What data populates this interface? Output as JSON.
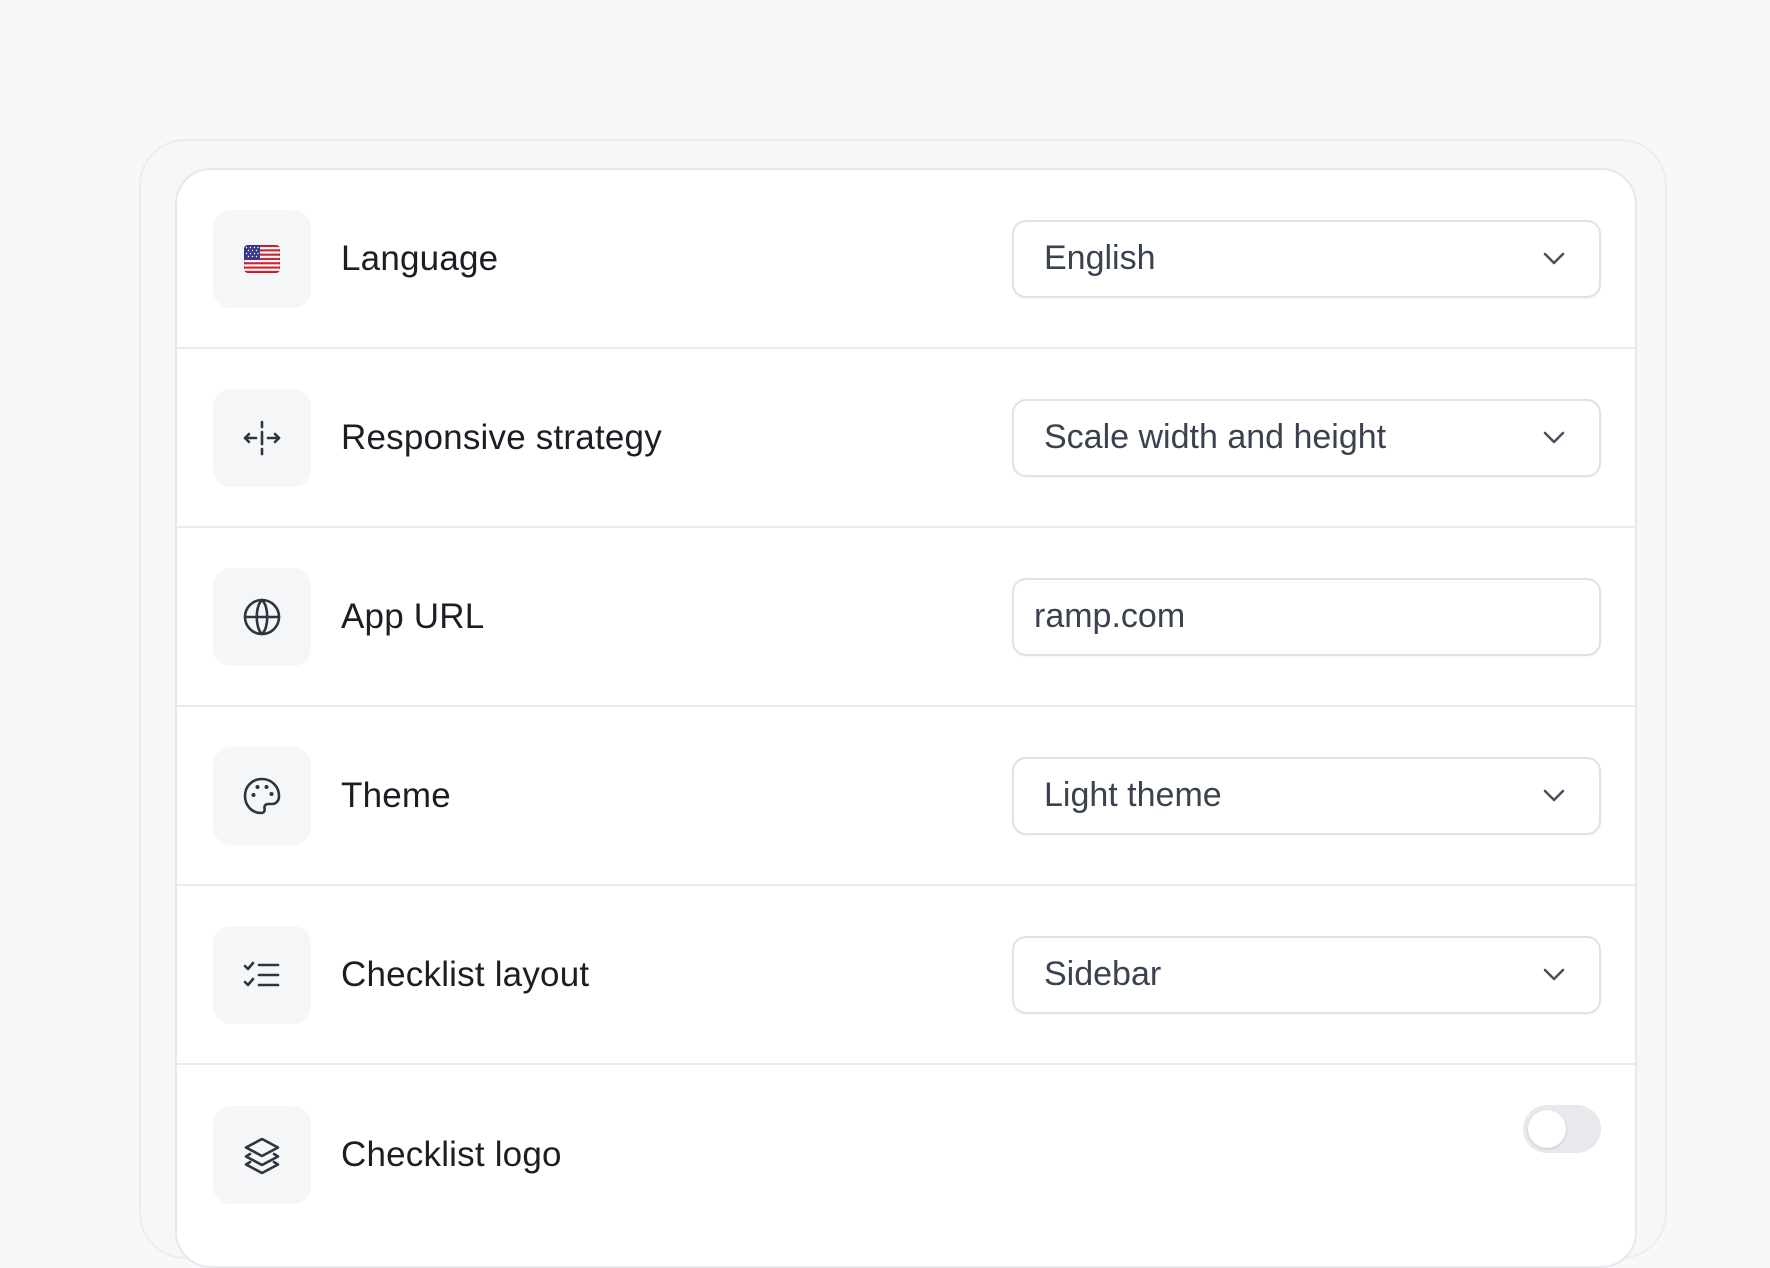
{
  "settings": {
    "rows": [
      {
        "icon": "us-flag-icon",
        "label": "Language",
        "control": "select",
        "value": "English"
      },
      {
        "icon": "resize-arrows-icon",
        "label": "Responsive strategy",
        "control": "select",
        "value": "Scale width and height"
      },
      {
        "icon": "globe-icon",
        "label": "App URL",
        "control": "input",
        "value": "ramp.com"
      },
      {
        "icon": "palette-icon",
        "label": "Theme",
        "control": "select",
        "value": "Light theme"
      },
      {
        "icon": "checklist-icon",
        "label": "Checklist layout",
        "control": "select",
        "value": "Sidebar"
      },
      {
        "icon": "layers-icon",
        "label": "Checklist logo",
        "control": "toggle",
        "value": false
      }
    ]
  },
  "colors": {
    "page_bg": "#f7f8fa",
    "panel_bg": "#ffffff",
    "icon_tile_bg": "#f5f6f8",
    "border": "#dfe2e6",
    "text_primary": "#1b1f24",
    "text_value": "#3a4250",
    "toggle_off": "#e7e9ec"
  }
}
